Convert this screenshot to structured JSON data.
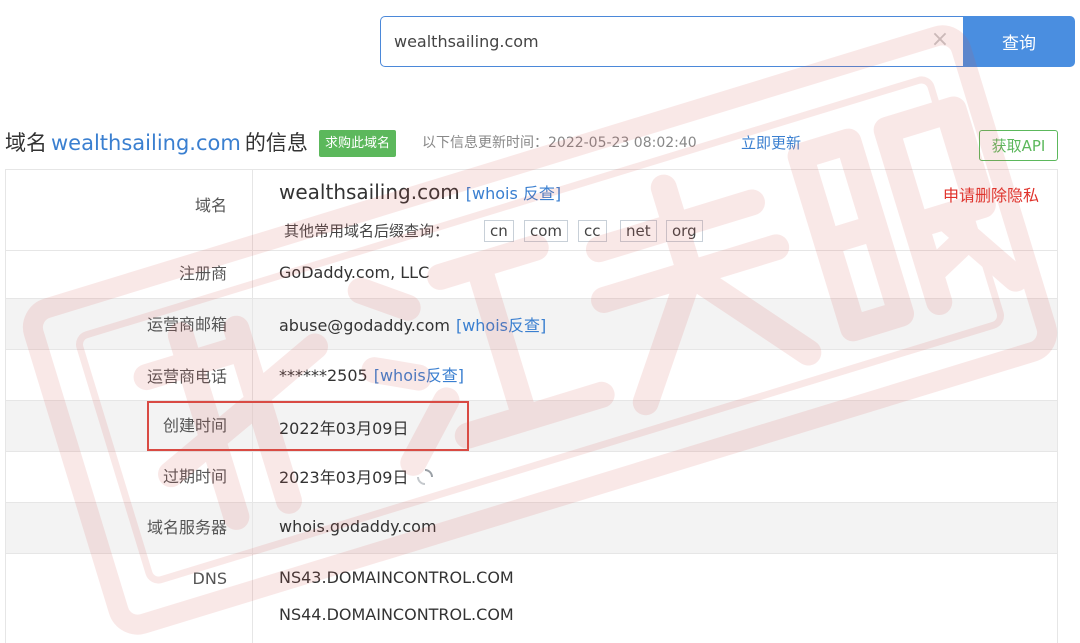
{
  "search": {
    "value": "wealthsailing.com",
    "clear_icon": "×",
    "button_label": "查询"
  },
  "header": {
    "title_prefix": "域名",
    "title_domain": "wealthsailing.com",
    "title_suffix": "的信息",
    "buy_badge": "求购此域名",
    "update_label": "以下信息更新时间：2022-05-23 08:02:40",
    "update_link": "立即更新",
    "api_button": "获取API"
  },
  "rows": {
    "domain": {
      "label": "域名",
      "value": "wealthsailing.com",
      "whois_link": "[whois 反查]",
      "privacy_link": "申请删除隐私",
      "suffix_label": "其他常用域名后缀查询：",
      "suffixes": [
        "cn",
        "com",
        "cc",
        "net",
        "org"
      ]
    },
    "registrar": {
      "label": "注册商",
      "value": "GoDaddy.com, LLC"
    },
    "email": {
      "label": "运营商邮箱",
      "value": "abuse@godaddy.com",
      "whois_link": "[whois反查]"
    },
    "phone": {
      "label": "运营商电话",
      "value": "******2505",
      "whois_link": "[whois反查]"
    },
    "created": {
      "label": "创建时间",
      "value": "2022年03月09日"
    },
    "expires": {
      "label": "过期时间",
      "value": "2023年03月09日"
    },
    "whois_server": {
      "label": "域名服务器",
      "value": "whois.godaddy.com"
    },
    "dns": {
      "label": "DNS",
      "values": [
        "NS43.DOMAINCONTROL.COM",
        "NS44.DOMAINCONTROL.COM"
      ]
    }
  },
  "colors": {
    "accent_blue": "#4a8ee0",
    "link_blue": "#3a7fd0",
    "badge_green": "#5cb85c",
    "privacy_red": "#e0322b",
    "highlight_red": "#d94a43",
    "watermark_red": "#d9534f"
  },
  "watermark_icon": "stamp-watermark-icon"
}
